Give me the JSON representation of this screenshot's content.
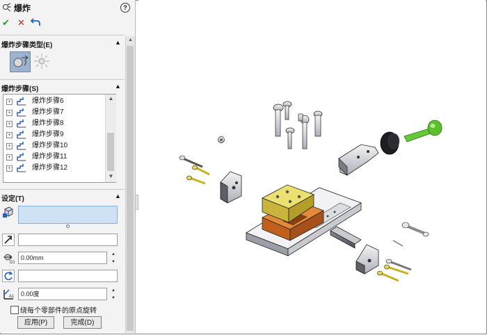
{
  "property_manager": {
    "title": "爆炸",
    "help_glyph": "?",
    "ok_glyph": "✔",
    "cancel_glyph": "✕",
    "sections": {
      "type": {
        "label": "爆炸步骤类型(E)"
      },
      "steps": {
        "label": "爆炸步骤(S)"
      },
      "settings": {
        "label": "设定(T)"
      }
    },
    "explode_steps": [
      "爆炸步骤6",
      "爆炸步骤7",
      "爆炸步骤8",
      "爆炸步骤9",
      "爆炸步骤10",
      "爆炸步骤11",
      "爆炸步骤12"
    ],
    "settings": {
      "distance_value": "0.00mm",
      "angle_value": "0.00度",
      "rotate_about_origin_label": "绕每个零部件的原点旋转"
    },
    "buttons": {
      "apply": "应用(P)",
      "done": "完成(D)"
    }
  },
  "colors": {
    "accent_selected": "#9db2cf",
    "active_field": "#cfe2f5",
    "ok_green": "#2a9a2a",
    "cancel_red": "#d21f1f",
    "part_brass": "#d9c24a",
    "part_copper": "#c9691f",
    "part_green_handle": "#56c02b"
  }
}
